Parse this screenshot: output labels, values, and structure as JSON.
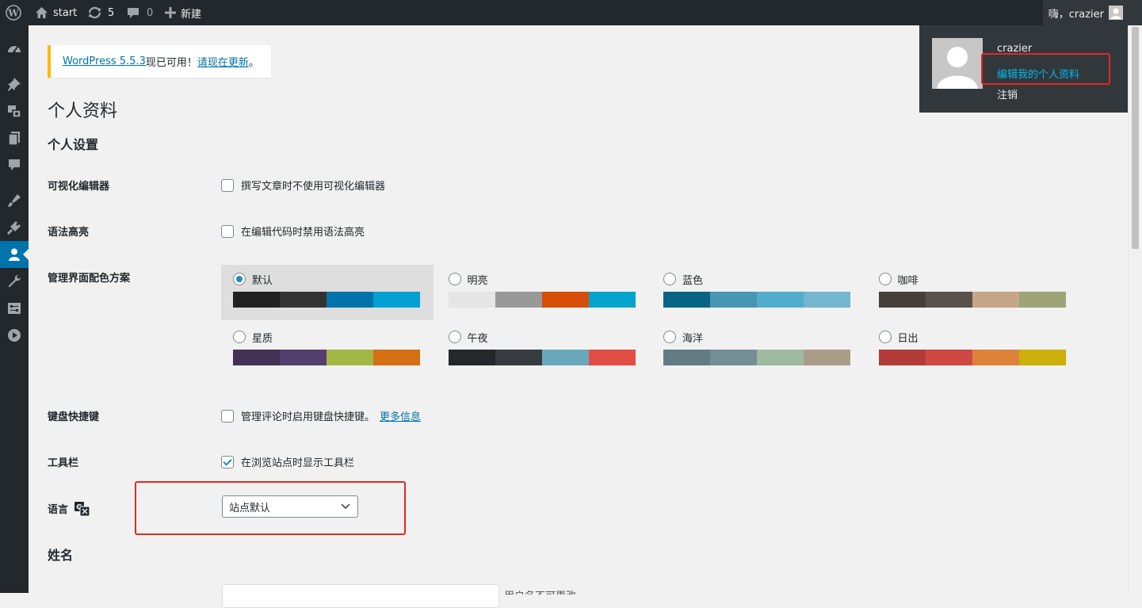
{
  "admin_bar": {
    "logo_icon": "wordpress-logo-icon",
    "site_name": "start",
    "updates_count": "5",
    "comments_count": "0",
    "new_label": "新建",
    "account_greeting": "嗨，crazier"
  },
  "account_menu": {
    "username": "crazier",
    "edit_profile": "编辑我的个人资料",
    "logout": "注销"
  },
  "notice": {
    "link_version": "WordPress 5.5.3",
    "text_middle": "现已可用！",
    "link_update": "请现在更新",
    "text_end": "。"
  },
  "page": {
    "title": "个人资料",
    "section_personal": "个人设置",
    "section_name": "姓名"
  },
  "fields": {
    "visual_editor": {
      "label": "可视化编辑器",
      "option": "撰写文章时不使用可视化编辑器",
      "checked": false
    },
    "syntax_highlight": {
      "label": "语法高亮",
      "option": "在编辑代码时禁用语法高亮",
      "checked": false
    },
    "color_scheme": {
      "label": "管理界面配色方案"
    },
    "keyboard_shortcuts": {
      "label": "键盘快捷键",
      "option": "管理评论时启用键盘快捷键。",
      "link": "更多信息",
      "checked": false
    },
    "toolbar": {
      "label": "工具栏",
      "option": "在浏览站点时显示工具栏",
      "checked": true
    },
    "language": {
      "label": "语言",
      "icon": "translation-icon",
      "selected": "站点默认"
    }
  },
  "color_schemes": [
    {
      "name": "默认",
      "selected": true,
      "colors": [
        "#222222",
        "#333333",
        "#0073aa",
        "#00a0d2"
      ]
    },
    {
      "name": "明亮",
      "selected": false,
      "colors": [
        "#e5e5e5",
        "#999999",
        "#d64e07",
        "#04a4cc"
      ]
    },
    {
      "name": "蓝色",
      "selected": false,
      "colors": [
        "#096484",
        "#4796b3",
        "#52accc",
        "#74b6ce"
      ]
    },
    {
      "name": "咖啡",
      "selected": false,
      "colors": [
        "#46403c",
        "#59524c",
        "#c7a589",
        "#9ea476"
      ]
    },
    {
      "name": "星质",
      "selected": false,
      "colors": [
        "#413256",
        "#523f6d",
        "#a3b745",
        "#d46f15"
      ]
    },
    {
      "name": "午夜",
      "selected": false,
      "colors": [
        "#25282b",
        "#363b3f",
        "#69a8bb",
        "#e14d43"
      ]
    },
    {
      "name": "海洋",
      "selected": false,
      "colors": [
        "#627c83",
        "#738e96",
        "#9ebaa0",
        "#aa9d88"
      ]
    },
    {
      "name": "日出",
      "selected": false,
      "colors": [
        "#b43c38",
        "#cf4944",
        "#dd823b",
        "#ccaf0b"
      ]
    }
  ],
  "sidebar_icons": [
    "dashboard-icon",
    "posts-pin-icon",
    "media-icon",
    "pages-icon",
    "comments-icon",
    "appearance-icon",
    "plugins-icon",
    "users-icon",
    "tools-icon",
    "settings-icon",
    "collapse-play-icon"
  ],
  "partial_text": "用户名不可更改。",
  "colors": {
    "admin_bar": "#23282d",
    "accent": "#0073aa",
    "highlight": "#e02b20"
  }
}
